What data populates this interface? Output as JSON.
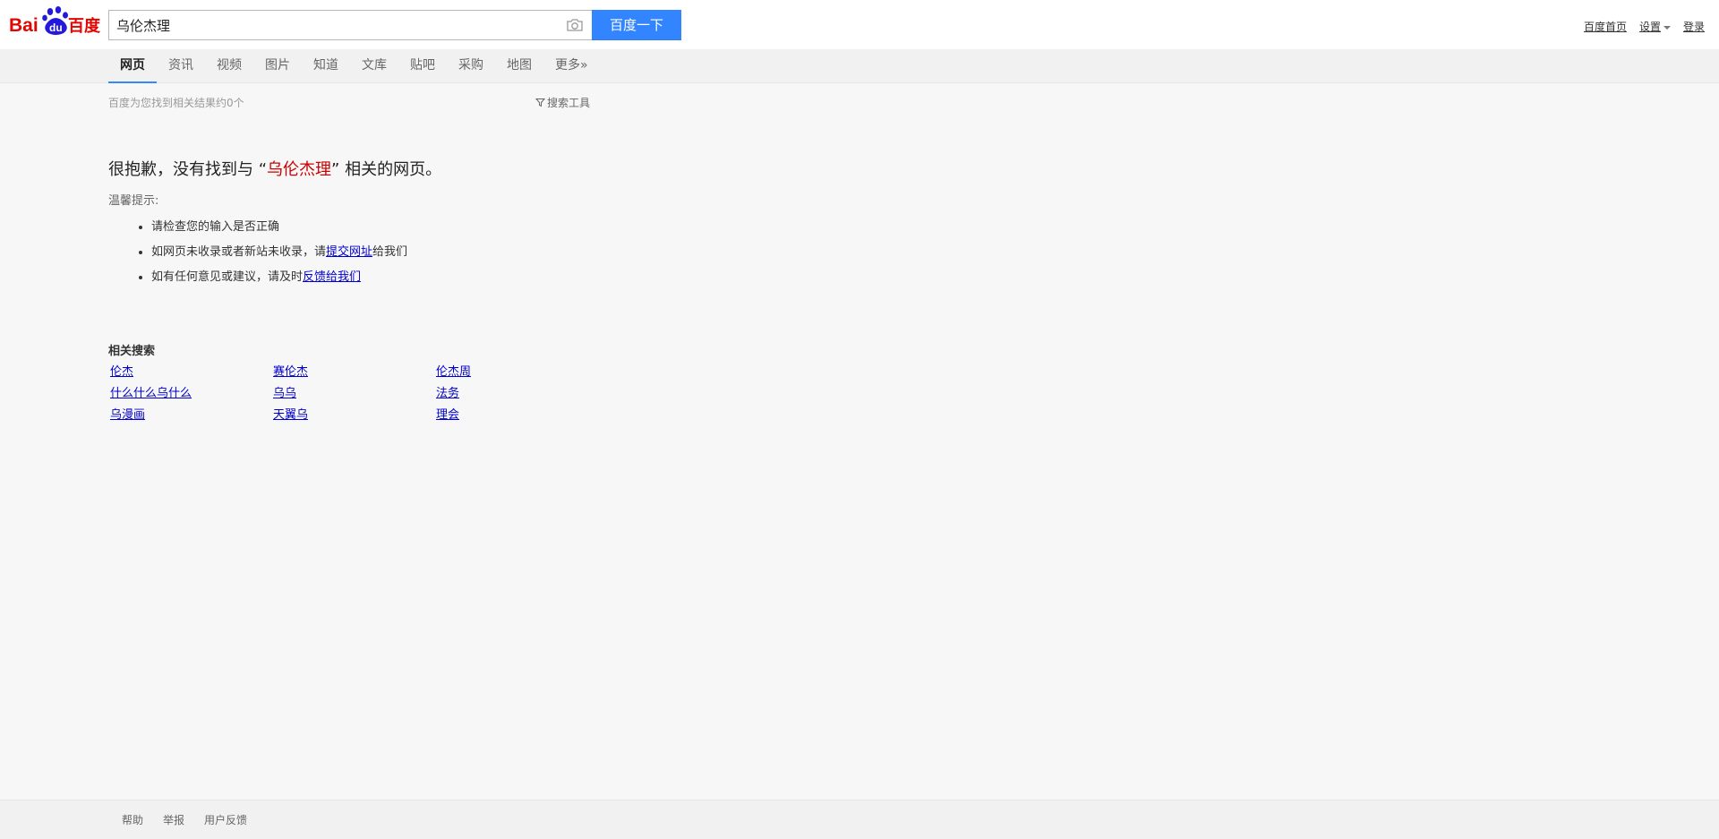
{
  "header": {
    "logo_text": "Bai du 百度",
    "query": "乌伦杰理",
    "search_button": "百度一下",
    "links": {
      "home": "百度首页",
      "settings": "设置",
      "login": "登录"
    }
  },
  "tabs": [
    {
      "label": "网页",
      "active": true
    },
    {
      "label": "资讯",
      "active": false
    },
    {
      "label": "视频",
      "active": false
    },
    {
      "label": "图片",
      "active": false
    },
    {
      "label": "知道",
      "active": false
    },
    {
      "label": "文库",
      "active": false
    },
    {
      "label": "贴吧",
      "active": false
    },
    {
      "label": "采购",
      "active": false
    },
    {
      "label": "地图",
      "active": false
    },
    {
      "label": "更多»",
      "active": false
    }
  ],
  "meta": {
    "result_count": "百度为您找到相关结果约0个",
    "search_tools": "搜索工具"
  },
  "no_result": {
    "prefix": "很抱歉，没有找到与 “",
    "keyword": "乌伦杰理",
    "suffix": "” 相关的网页。",
    "tips_title": "温馨提示:",
    "tips": {
      "tip1": "请检查您的输入是否正确",
      "tip2_prefix": "如网页未收录或者新站未收录，请",
      "tip2_link": "提交网址",
      "tip2_suffix": "给我们",
      "tip3_prefix": "如有任何意见或建议，请及时",
      "tip3_link": "反馈给我们"
    }
  },
  "related": {
    "title": "相关搜索",
    "items": [
      "伦杰",
      "赛伦杰",
      "伦杰周",
      "什么什么乌什么",
      "乌乌",
      "法务",
      "乌漫画",
      "天翼乌",
      "理会"
    ]
  },
  "footer": {
    "links": [
      "帮助",
      "举报",
      "用户反馈"
    ]
  },
  "colors": {
    "accent": "#3385ff",
    "keyword": "#cc0000",
    "link": "#0000cc",
    "logo_red": "#e10602",
    "logo_blue": "#2319dc"
  }
}
